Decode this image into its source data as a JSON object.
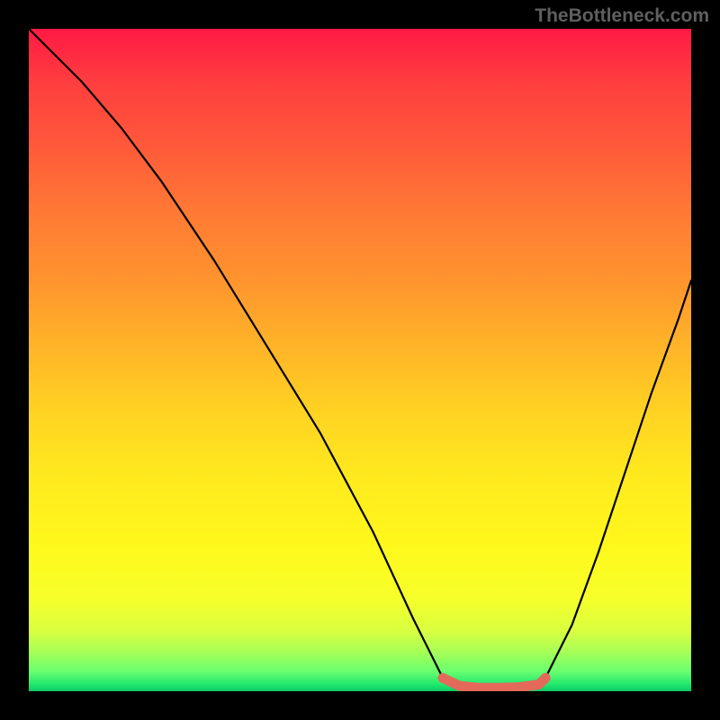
{
  "watermark": "TheBottleneck.com",
  "chart_data": {
    "type": "line",
    "title": "",
    "xlabel": "",
    "ylabel": "",
    "xlim": [
      0,
      100
    ],
    "ylim": [
      0,
      100
    ],
    "grid": false,
    "legend": false,
    "background_gradient": {
      "direction": "vertical",
      "stops": [
        {
          "pos": 0.0,
          "color": "#ff1a44"
        },
        {
          "pos": 0.5,
          "color": "#ffb428"
        },
        {
          "pos": 0.8,
          "color": "#fff81c"
        },
        {
          "pos": 1.0,
          "color": "#0dc965"
        }
      ]
    },
    "series": [
      {
        "name": "left-curve",
        "color": "#000000",
        "x": [
          0,
          3,
          8,
          14,
          20,
          28,
          36,
          44,
          52,
          58,
          62.5
        ],
        "y": [
          100,
          97,
          92,
          85,
          77,
          65,
          52,
          39,
          24,
          11,
          2
        ]
      },
      {
        "name": "right-curve",
        "color": "#000000",
        "x": [
          78,
          82,
          86,
          90,
          94,
          98,
          100
        ],
        "y": [
          2,
          10,
          21,
          33,
          45,
          56,
          62
        ]
      },
      {
        "name": "trough-highlight",
        "color": "#e4695a",
        "x": [
          62.5,
          65,
          68,
          71,
          74,
          77,
          78
        ],
        "y": [
          2,
          0.8,
          0.5,
          0.5,
          0.6,
          1.0,
          2
        ]
      }
    ],
    "note": "Values are read in percentage coordinates relative to the colored plot area (0,0 bottom-left, 100,100 top-right). Estimated from pixel positions."
  }
}
